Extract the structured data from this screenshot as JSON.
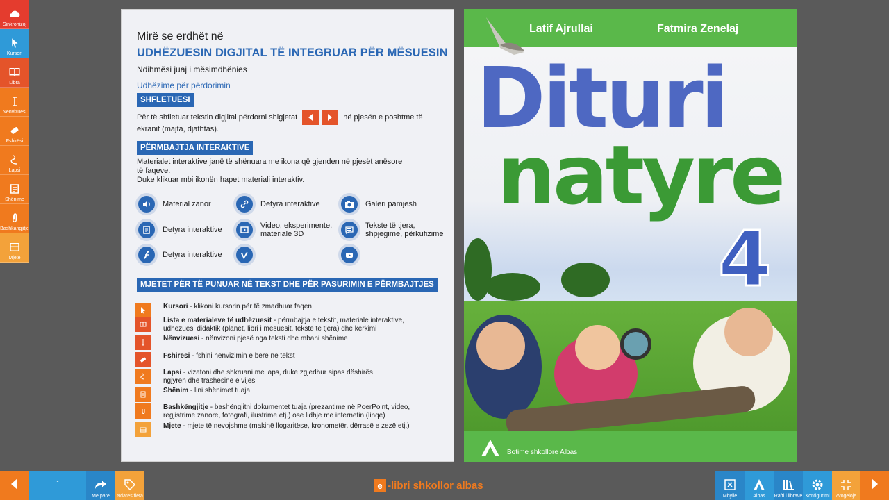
{
  "toolbar": {
    "items": [
      {
        "label": "Sinkronizoj",
        "icon": "cloud-icon",
        "color": "#e43c2e"
      },
      {
        "label": "Kursori",
        "icon": "cursor-icon",
        "color": "#2f9ad8"
      },
      {
        "label": "Libra",
        "icon": "book-icon",
        "color": "#e4542a"
      },
      {
        "label": "Nënvizuesi",
        "icon": "text-cursor-icon",
        "color": "#f07a1e"
      },
      {
        "label": "Fshirësi",
        "icon": "eraser-icon",
        "color": "#f07a1e"
      },
      {
        "label": "Lapsi",
        "icon": "pencil-icon",
        "color": "#f07a1e"
      },
      {
        "label": "Shënime",
        "icon": "notes-icon",
        "color": "#f07a1e"
      },
      {
        "label": "Bashkangjitje",
        "icon": "paperclip-icon",
        "color": "#f07a1e"
      },
      {
        "label": "Mjete",
        "icon": "tools-box-icon",
        "color": "#f3a23a"
      }
    ]
  },
  "left_page": {
    "welcome": "Mirë se erdhët në",
    "title": "UDHËZUESIN DIGJITAL TË INTEGRUAR PËR MËSUESIN",
    "subtitle": "Ndihmësi juaj i mësimdhënies",
    "instructions_link": "Udhëzime për përdorimin",
    "section1": {
      "heading": "SHFLETUESI",
      "text_a": "Për të shfletuar tekstin digjital përdorni shigjetat",
      "text_b": "në pjesën e poshtme të",
      "text_c": "ekranit (majta, djathtas)."
    },
    "section2": {
      "heading": "PËRMBAJTJA INTERAKTIVE",
      "line1": "Materialet interaktive janë të shënuara me ikona që gjenden në pjesët anësore",
      "line2": "të faqeve.",
      "line3": "Duke klikuar mbi ikonën hapet materiali interaktiv."
    },
    "icons": [
      {
        "label": "Material zanor",
        "icon": "speaker-icon"
      },
      {
        "label": "Detyra interaktive",
        "icon": "link-icon"
      },
      {
        "label": "Galeri pamjesh",
        "icon": "camera-icon"
      },
      {
        "label": "Detyra interaktive",
        "icon": "document-icon"
      },
      {
        "label": "Video, eksperimente,",
        "label2": "materiale 3D",
        "icon": "video-icon"
      },
      {
        "label": "Tekste të tjera,",
        "label2": "shpjegime, përkufizime",
        "icon": "speech-bubble-icon"
      },
      {
        "label": "Detyra interaktive",
        "icon": "flash-icon"
      },
      {
        "label": "",
        "icon": "vimeo-icon"
      },
      {
        "label": "",
        "icon": "youtube-icon"
      }
    ],
    "section3": {
      "heading": "MJETET PËR TË PUNUAR NË TEKST DHE PËR PASURIMIN E PËRMBAJTJES"
    },
    "tools": [
      {
        "name": "Kursori",
        "desc": " - klikoni kursorin për të zmadhuar faqen",
        "desc2": "",
        "icon": "cursor-icon",
        "color": "#f07a1e"
      },
      {
        "name": "Lista e materialeve të udhëzuesit",
        "desc": " - përmbajtja e tekstit, materiale interaktive,",
        "desc2": "udhëzuesi didaktik (planet, libri i mësuesit, tekste të tjera) dhe kërkimi",
        "icon": "book-icon",
        "color": "#e4542a"
      },
      {
        "name": "Nënvizuesi",
        "desc": " - nënvizoni pjesë nga teksti dhe mbani shënime",
        "desc2": "",
        "icon": "text-cursor-icon",
        "color": "#e4542a"
      },
      {
        "name": "Fshirësi",
        "desc": " - fshini nënvizimin e bërë në tekst",
        "desc2": "",
        "icon": "eraser-icon",
        "color": "#e4542a"
      },
      {
        "name": "Lapsi",
        "desc": " - vizatoni dhe shkruani me laps, duke zgjedhur sipas dëshirës",
        "desc2": "ngjyrën dhe trashësinë e vijës",
        "icon": "pencil-icon",
        "color": "#f07a1e"
      },
      {
        "name": "Shënim",
        "desc": " - lini shënimet tuaja",
        "desc2": "",
        "icon": "notes-icon",
        "color": "#f07a1e"
      },
      {
        "name": "Bashkëngjitje",
        "desc": " - bashëngjitni dokumentet tuaja (prezantime në PoerPoint, video,",
        "desc2": "regjistrime zanore, fotografi, ilustrime etj.) ose lidhje me internetin (linqe)",
        "icon": "paperclip-icon",
        "color": "#f07a1e"
      },
      {
        "name": "Mjete",
        "desc": " - mjete të nevojshme (makinë llogaritëse, kronometër, dërrasë e zezë etj.)",
        "desc2": "",
        "icon": "tools-box-icon",
        "color": "#f3a23a"
      }
    ]
  },
  "cover": {
    "author1": "Latif Ajrullai",
    "author2": "Fatmira Zenelaj",
    "title_line1": "Dituri",
    "title_line2": "natyre",
    "grade": "4",
    "publisher": "Botime shkollore Albas"
  },
  "bottom": {
    "page_indicator": "-",
    "btn_prev_view": "Më parë",
    "btn_bookmarks": "Ndarës fleta",
    "brand": "-libri shkollor albas",
    "brand_letter": "e",
    "btn_close": "Mbylle",
    "btn_albas": "Albas",
    "btn_shelf": "Rafti i librave",
    "btn_config": "Konfigurimi",
    "btn_zoom": "Zvogëloje"
  }
}
